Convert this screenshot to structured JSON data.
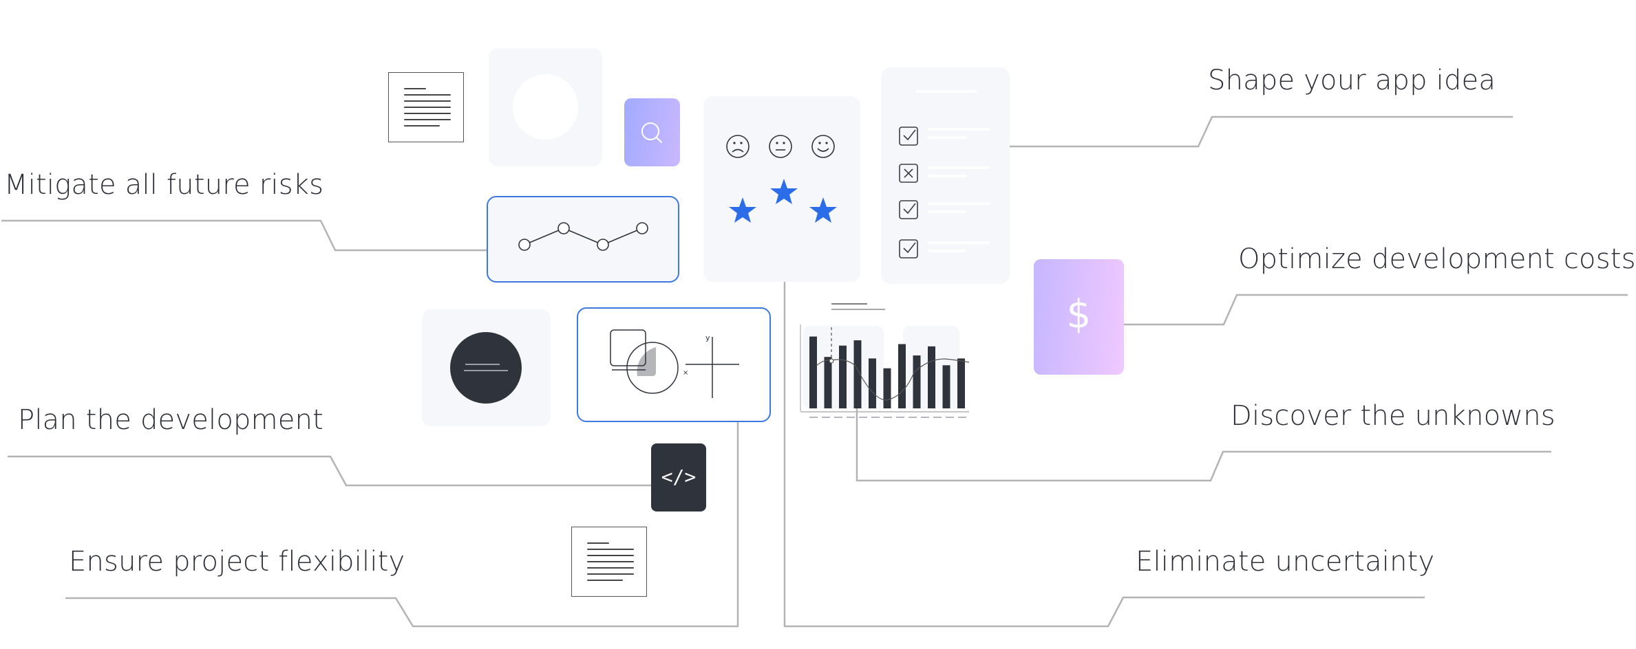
{
  "labels": {
    "shape_app_idea": "Shape your app idea",
    "mitigate_risks": "Mitigate all future risks",
    "optimize_costs": "Optimize development costs",
    "plan_development": "Plan the development",
    "discover_unknowns": "Discover the unknowns",
    "ensure_flexibility": "Ensure project flexibility",
    "eliminate_uncertainty": "Eliminate uncertainty"
  },
  "icons": {
    "search": "search-icon",
    "dollar": "$",
    "code": "</>",
    "faces": [
      "sad-face-icon",
      "neutral-face-icon",
      "happy-face-icon"
    ],
    "stars_count": 3,
    "checklist": [
      "checked",
      "crossed",
      "checked",
      "checked"
    ]
  },
  "colors": {
    "star": "#2b6de8",
    "card_outline": "#3b78e0",
    "dark_card": "#2f333b",
    "connector": "#b3b3b6",
    "text": "#2b2e36",
    "card_bg": "#f6f7fb"
  },
  "line_chart_card": {
    "points": [
      0.3,
      0.75,
      0.3,
      0.75
    ]
  },
  "bar_chart_card": {
    "bars": [
      0.95,
      0.68,
      0.83,
      0.9,
      0.66,
      0.53,
      0.85,
      0.7,
      0.82,
      0.57,
      0.66
    ]
  }
}
